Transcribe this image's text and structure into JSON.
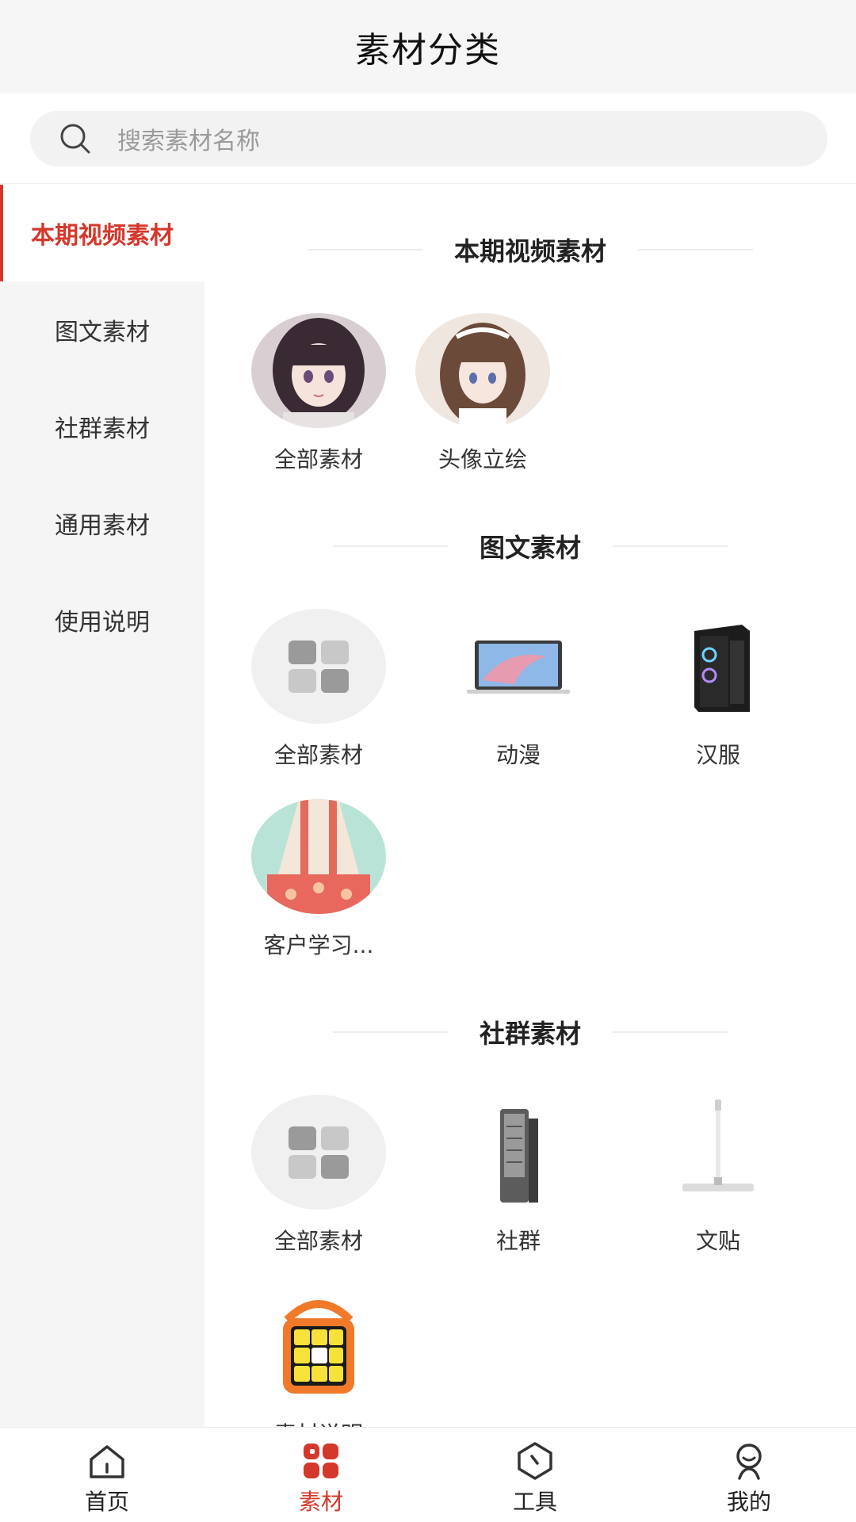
{
  "header": {
    "title": "素材分类"
  },
  "search": {
    "placeholder": "搜索素材名称"
  },
  "sidebar": {
    "items": [
      {
        "label": "本期视频素材",
        "active": true
      },
      {
        "label": "图文素材",
        "active": false
      },
      {
        "label": "社群素材",
        "active": false
      },
      {
        "label": "通用素材",
        "active": false
      },
      {
        "label": "使用说明",
        "active": false
      }
    ]
  },
  "sections": [
    {
      "title": "本期视频素材",
      "items": [
        {
          "label": "全部素材",
          "icon": "anime-girl-portrait"
        },
        {
          "label": "头像立绘",
          "icon": "anime-girl-maid"
        }
      ]
    },
    {
      "title": "图文素材",
      "items": [
        {
          "label": "全部素材",
          "icon": "grid-icon"
        },
        {
          "label": "动漫",
          "icon": "laptop-icon"
        },
        {
          "label": "汉服",
          "icon": "pc-tower-icon"
        },
        {
          "label": "客户学习...",
          "icon": "hanfu-skirt"
        }
      ]
    },
    {
      "title": "社群素材",
      "items": [
        {
          "label": "全部素材",
          "icon": "grid-icon"
        },
        {
          "label": "社群",
          "icon": "tool-case-icon"
        },
        {
          "label": "文贴",
          "icon": "mop-icon"
        },
        {
          "label": "素材说明",
          "icon": "cube-speaker-icon"
        }
      ]
    }
  ],
  "tabbar": {
    "tabs": [
      {
        "label": "首页",
        "icon": "home-icon",
        "active": false
      },
      {
        "label": "素材",
        "icon": "apps-icon",
        "active": true
      },
      {
        "label": "工具",
        "icon": "compass-icon",
        "active": false
      },
      {
        "label": "我的",
        "icon": "user-icon",
        "active": false
      }
    ]
  },
  "colors": {
    "accent": "#d4382b",
    "sidebar_bg": "#f5f5f5",
    "header_bg": "#f6f6f6"
  }
}
